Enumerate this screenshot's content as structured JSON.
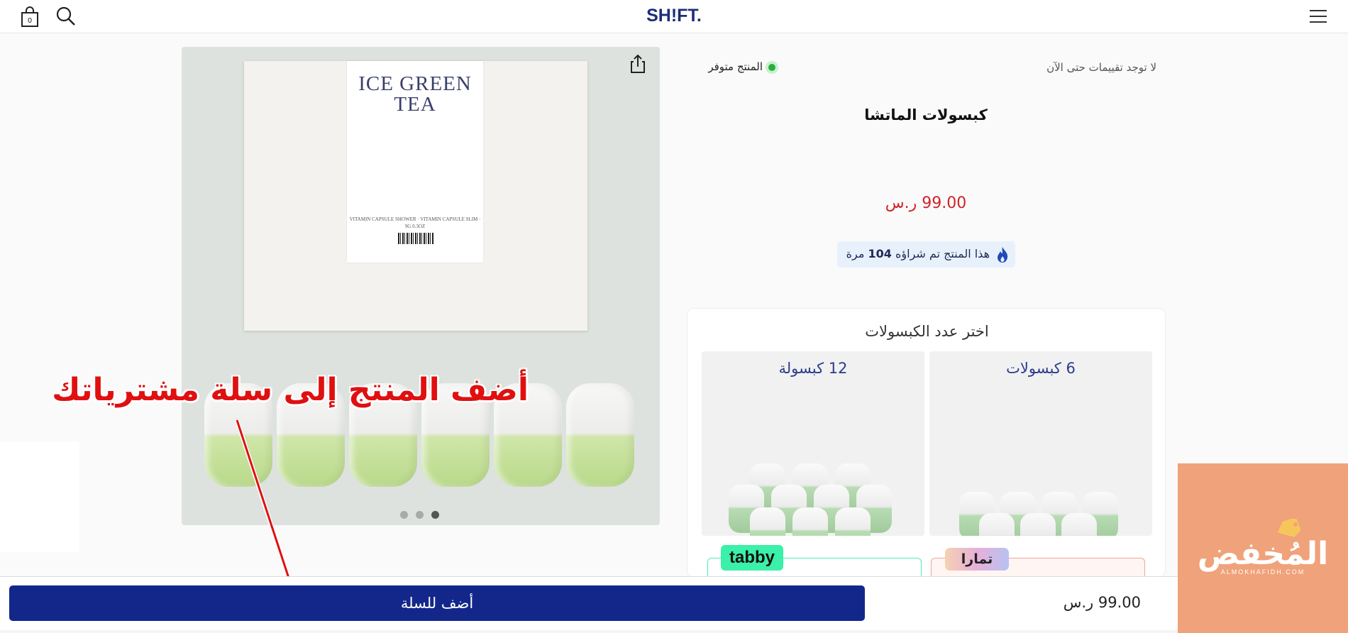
{
  "header": {
    "logo": "SH!FT.",
    "cart_count": "0",
    "icons": [
      "cart-icon",
      "search-icon",
      "hamburger-menu-icon"
    ]
  },
  "product": {
    "rating_text": "لا توجد تقييمات حتى الآن",
    "stock_status": "المنتج متوفر",
    "title": "كبسولات الماتشا",
    "price": "99.00 ر.س",
    "sold_prefix": "هذا المنتج تم شراؤه",
    "sold_count": "104",
    "sold_suffix": "مرة",
    "image_box_title": "ICE GREEN TEA",
    "image_box_fineprint": "VITAMIN CAPSULE SHOWER · VITAMIN CAPSULE SLIM · 9G 0.3OZ",
    "image_dots": {
      "total": 3,
      "active_index": 2
    }
  },
  "options": {
    "title": "اختر عدد الكبسولات",
    "items": [
      {
        "label": "6 كبسولات"
      },
      {
        "label": "12 كبسولة"
      }
    ]
  },
  "payments": {
    "tabby_label": "tabby",
    "tamara_label": "تمارا"
  },
  "annotation": {
    "text": "أضف المنتج إلى سلة مشترياتك"
  },
  "bottom_bar": {
    "add_to_cart": "أضف للسلة",
    "price": "99.00 ر.س"
  },
  "watermark": {
    "text": "المُخفض",
    "sub": "ALMOKHAFIDH.COM"
  },
  "colors": {
    "brand_navy": "#13278b",
    "price_red": "#d0232b",
    "stock_green": "#27b041",
    "watermark_orange": "#f0a27a"
  }
}
